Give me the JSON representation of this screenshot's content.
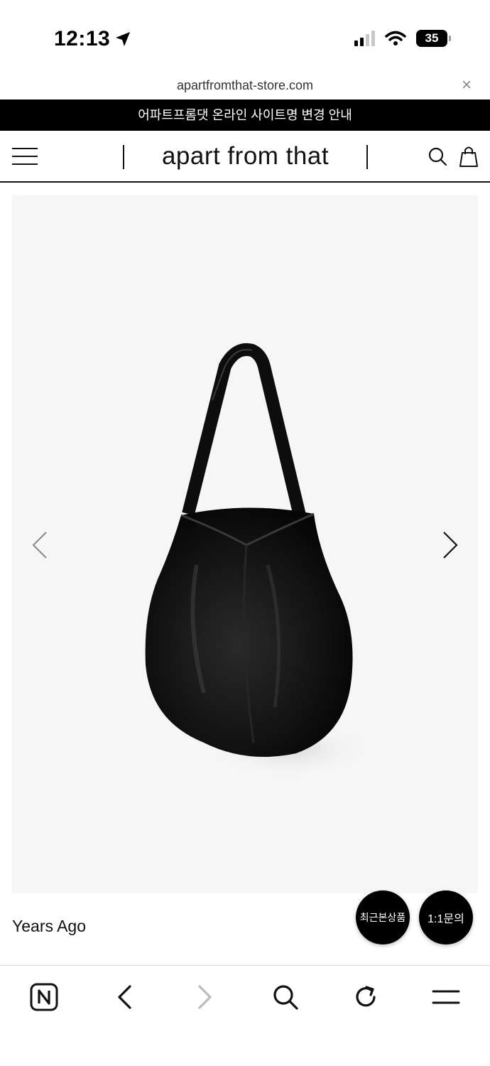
{
  "status": {
    "time": "12:13",
    "battery": "35"
  },
  "browser": {
    "url": "apartfromthat-store.com",
    "close_label": "×"
  },
  "announcement": "어파트프롬댓 온라인 사이트명 변경 안내",
  "header": {
    "brand": "apart from that"
  },
  "product": {
    "name": "Years Ago"
  },
  "floating": {
    "recent_label": "최근본상품",
    "inquiry_label": "1:1문의"
  },
  "icons": {
    "menu": "hamburger-menu-icon",
    "search": "search-icon",
    "cart": "shopping-bag-icon",
    "prev": "chevron-left-icon",
    "next": "chevron-right-icon",
    "naver": "naver-n-icon",
    "back": "back-icon",
    "forward": "forward-icon",
    "reload": "reload-icon",
    "browser_menu": "browser-menu-icon"
  },
  "colors": {
    "announcement_bg": "#000000",
    "image_bg": "#f6f6f6",
    "floating_bg": "#000000"
  }
}
